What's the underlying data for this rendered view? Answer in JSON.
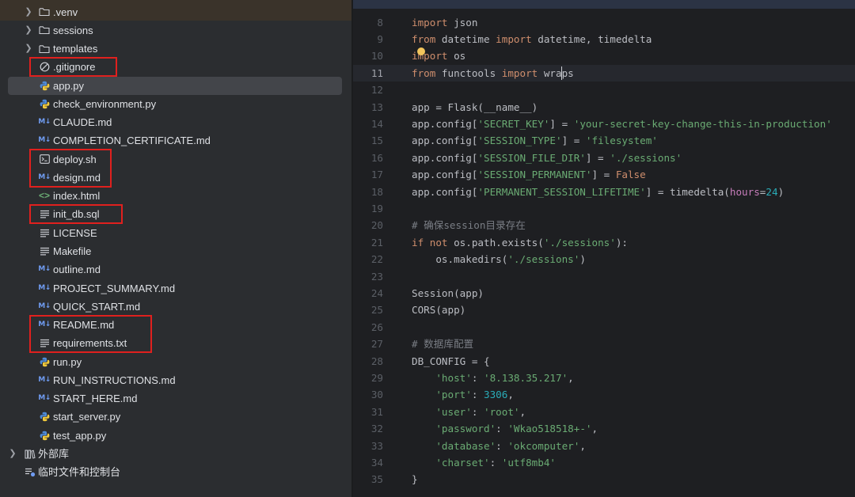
{
  "project_tree": {
    "items": [
      {
        "name": ".venv",
        "kind": "folder",
        "expandable": true
      },
      {
        "name": "sessions",
        "kind": "folder",
        "expandable": true
      },
      {
        "name": "templates",
        "kind": "folder",
        "expandable": true
      },
      {
        "name": ".gitignore",
        "kind": "ignore",
        "highlight": true
      },
      {
        "name": "app.py",
        "kind": "python",
        "selected": true
      },
      {
        "name": "check_environment.py",
        "kind": "python"
      },
      {
        "name": "CLAUDE.md",
        "kind": "markdown"
      },
      {
        "name": "COMPLETION_CERTIFICATE.md",
        "kind": "markdown"
      },
      {
        "name": "deploy.sh",
        "kind": "shell",
        "highlight": true
      },
      {
        "name": "design.md",
        "kind": "markdown",
        "highlight": true
      },
      {
        "name": "index.html",
        "kind": "html"
      },
      {
        "name": "init_db.sql",
        "kind": "text",
        "highlight": true
      },
      {
        "name": "LICENSE",
        "kind": "text"
      },
      {
        "name": "Makefile",
        "kind": "text"
      },
      {
        "name": "outline.md",
        "kind": "markdown"
      },
      {
        "name": "PROJECT_SUMMARY.md",
        "kind": "markdown"
      },
      {
        "name": "QUICK_START.md",
        "kind": "markdown"
      },
      {
        "name": "README.md",
        "kind": "markdown",
        "highlight": true
      },
      {
        "name": "requirements.txt",
        "kind": "text",
        "highlight": true
      },
      {
        "name": "run.py",
        "kind": "python"
      },
      {
        "name": "RUN_INSTRUCTIONS.md",
        "kind": "markdown"
      },
      {
        "name": "START_HERE.md",
        "kind": "markdown"
      },
      {
        "name": "start_server.py",
        "kind": "python"
      },
      {
        "name": "test_app.py",
        "kind": "python"
      },
      {
        "name": "外部库",
        "kind": "library",
        "expandable": true
      },
      {
        "name": "临时文件和控制台",
        "kind": "scratch"
      }
    ]
  },
  "editor": {
    "current_line": 11,
    "lines": [
      {
        "n": "8",
        "tokens": [
          [
            "kw",
            "import"
          ],
          [
            "plain",
            " json"
          ]
        ]
      },
      {
        "n": "9",
        "tokens": [
          [
            "kw",
            "from"
          ],
          [
            "plain",
            " datetime "
          ],
          [
            "kw",
            "import"
          ],
          [
            "plain",
            " datetime, timedelta"
          ]
        ]
      },
      {
        "n": "10",
        "tokens": [
          [
            "kw",
            "import"
          ],
          [
            "plain",
            " os"
          ]
        ]
      },
      {
        "n": "11",
        "tokens": [
          [
            "kw",
            "from"
          ],
          [
            "plain",
            " functools "
          ],
          [
            "kw",
            "import"
          ],
          [
            "plain",
            " wraps"
          ]
        ]
      },
      {
        "n": "12",
        "tokens": []
      },
      {
        "n": "13",
        "tokens": [
          [
            "plain",
            "app = Flask(__name__)"
          ]
        ]
      },
      {
        "n": "14",
        "tokens": [
          [
            "plain",
            "app.config["
          ],
          [
            "str",
            "'SECRET_KEY'"
          ],
          [
            "plain",
            "] = "
          ],
          [
            "str",
            "'your-secret-key-change-this-in-production'"
          ]
        ]
      },
      {
        "n": "15",
        "tokens": [
          [
            "plain",
            "app.config["
          ],
          [
            "str",
            "'SESSION_TYPE'"
          ],
          [
            "plain",
            "] = "
          ],
          [
            "str",
            "'filesystem'"
          ]
        ]
      },
      {
        "n": "16",
        "tokens": [
          [
            "plain",
            "app.config["
          ],
          [
            "str",
            "'SESSION_FILE_DIR'"
          ],
          [
            "plain",
            "] = "
          ],
          [
            "str",
            "'./sessions'"
          ]
        ]
      },
      {
        "n": "17",
        "tokens": [
          [
            "plain",
            "app.config["
          ],
          [
            "str",
            "'SESSION_PERMANENT'"
          ],
          [
            "plain",
            "] = "
          ],
          [
            "kw",
            "False"
          ]
        ]
      },
      {
        "n": "18",
        "tokens": [
          [
            "plain",
            "app.config["
          ],
          [
            "str",
            "'PERMANENT_SESSION_LIFETIME'"
          ],
          [
            "plain",
            "] = timedelta("
          ],
          [
            "param",
            "hours"
          ],
          [
            "plain",
            "="
          ],
          [
            "num",
            "24"
          ],
          [
            "plain",
            ")"
          ]
        ]
      },
      {
        "n": "19",
        "tokens": []
      },
      {
        "n": "20",
        "tokens": [
          [
            "cmt",
            "# 确保session目录存在"
          ]
        ]
      },
      {
        "n": "21",
        "tokens": [
          [
            "kw",
            "if not"
          ],
          [
            "plain",
            " os.path.exists("
          ],
          [
            "str",
            "'./sessions'"
          ],
          [
            "plain",
            "):"
          ]
        ]
      },
      {
        "n": "22",
        "tokens": [
          [
            "plain",
            "    os.makedirs("
          ],
          [
            "str",
            "'./sessions'"
          ],
          [
            "plain",
            ")"
          ]
        ]
      },
      {
        "n": "23",
        "tokens": []
      },
      {
        "n": "24",
        "tokens": [
          [
            "plain",
            "Session(app)"
          ]
        ]
      },
      {
        "n": "25",
        "tokens": [
          [
            "plain",
            "CORS(app)"
          ]
        ]
      },
      {
        "n": "26",
        "tokens": []
      },
      {
        "n": "27",
        "tokens": [
          [
            "cmt",
            "# 数据库配置"
          ]
        ]
      },
      {
        "n": "28",
        "tokens": [
          [
            "plain",
            "DB_CONFIG = {"
          ]
        ]
      },
      {
        "n": "29",
        "tokens": [
          [
            "plain",
            "    "
          ],
          [
            "str",
            "'host'"
          ],
          [
            "plain",
            ": "
          ],
          [
            "str",
            "'8.138.35.217'"
          ],
          [
            "plain",
            ","
          ]
        ]
      },
      {
        "n": "30",
        "tokens": [
          [
            "plain",
            "    "
          ],
          [
            "str",
            "'port'"
          ],
          [
            "plain",
            ": "
          ],
          [
            "num",
            "3306"
          ],
          [
            "plain",
            ","
          ]
        ]
      },
      {
        "n": "31",
        "tokens": [
          [
            "plain",
            "    "
          ],
          [
            "str",
            "'user'"
          ],
          [
            "plain",
            ": "
          ],
          [
            "str",
            "'root'"
          ],
          [
            "plain",
            ","
          ]
        ]
      },
      {
        "n": "32",
        "tokens": [
          [
            "plain",
            "    "
          ],
          [
            "str",
            "'password'"
          ],
          [
            "plain",
            ": "
          ],
          [
            "str",
            "'Wkao518518+-'"
          ],
          [
            "plain",
            ","
          ]
        ]
      },
      {
        "n": "33",
        "tokens": [
          [
            "plain",
            "    "
          ],
          [
            "str",
            "'database'"
          ],
          [
            "plain",
            ": "
          ],
          [
            "str",
            "'okcomputer'"
          ],
          [
            "plain",
            ","
          ]
        ]
      },
      {
        "n": "34",
        "tokens": [
          [
            "plain",
            "    "
          ],
          [
            "str",
            "'charset'"
          ],
          [
            "plain",
            ": "
          ],
          [
            "str",
            "'utf8mb4'"
          ]
        ]
      },
      {
        "n": "35",
        "tokens": [
          [
            "plain",
            "}"
          ]
        ]
      }
    ]
  },
  "colors": {
    "keyword": "#cf8e6d",
    "string": "#6aab73",
    "number": "#2aacb8",
    "comment": "#7a7e85",
    "annotation_box": "#e0201e"
  }
}
